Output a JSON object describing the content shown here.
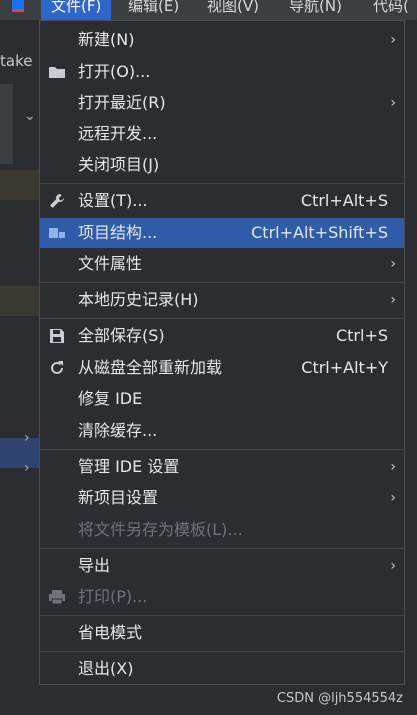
{
  "menubar": {
    "titles": [
      "文件(F)",
      "编辑(E)",
      "视图(V)",
      "导航(N)",
      "代码("
    ]
  },
  "background": {
    "tab_label": "take"
  },
  "menu": {
    "items": [
      {
        "label": "新建(N)",
        "shortcut": "",
        "submenu": true,
        "icon": ""
      },
      {
        "label": "打开(O)...",
        "shortcut": "",
        "submenu": false,
        "icon": "folder-icon"
      },
      {
        "label": "打开最近(R)",
        "shortcut": "",
        "submenu": true,
        "icon": ""
      },
      {
        "label": "远程开发...",
        "shortcut": "",
        "submenu": false,
        "icon": ""
      },
      {
        "label": "关闭项目(J)",
        "shortcut": "",
        "submenu": false,
        "icon": ""
      },
      {
        "label": "设置(T)...",
        "shortcut": "Ctrl+Alt+S",
        "submenu": false,
        "icon": "wrench-icon"
      },
      {
        "label": "项目结构...",
        "shortcut": "Ctrl+Alt+Shift+S",
        "submenu": false,
        "icon": "project-structure-icon",
        "highlighted": true
      },
      {
        "label": "文件属性",
        "shortcut": "",
        "submenu": true,
        "icon": ""
      },
      {
        "label": "本地历史记录(H)",
        "shortcut": "",
        "submenu": true,
        "icon": ""
      },
      {
        "label": "全部保存(S)",
        "shortcut": "Ctrl+S",
        "submenu": false,
        "icon": "save-icon"
      },
      {
        "label": "从磁盘全部重新加载",
        "shortcut": "Ctrl+Alt+Y",
        "submenu": false,
        "icon": "reload-icon"
      },
      {
        "label": "修复 IDE",
        "shortcut": "",
        "submenu": false,
        "icon": ""
      },
      {
        "label": "清除缓存...",
        "shortcut": "",
        "submenu": false,
        "icon": ""
      },
      {
        "label": "管理 IDE 设置",
        "shortcut": "",
        "submenu": true,
        "icon": ""
      },
      {
        "label": "新项目设置",
        "shortcut": "",
        "submenu": true,
        "icon": ""
      },
      {
        "label": "将文件另存为模板(L)...",
        "shortcut": "",
        "submenu": false,
        "icon": "",
        "disabled": true
      },
      {
        "label": "导出",
        "shortcut": "",
        "submenu": true,
        "icon": ""
      },
      {
        "label": "打印(P)...",
        "shortcut": "",
        "submenu": false,
        "icon": "printer-icon",
        "disabled": true
      },
      {
        "label": "省电模式",
        "shortcut": "",
        "submenu": false,
        "icon": ""
      },
      {
        "label": "退出(X)",
        "shortcut": "",
        "submenu": false,
        "icon": ""
      }
    ]
  },
  "watermark": "CSDN @ljh554554z",
  "colors": {
    "menu_bg": "#2b2d30",
    "highlight": "#2f5ca8",
    "active_menu_title": "#2f65ca",
    "text": "#e6e7ea",
    "disabled_text": "#6f737a"
  }
}
